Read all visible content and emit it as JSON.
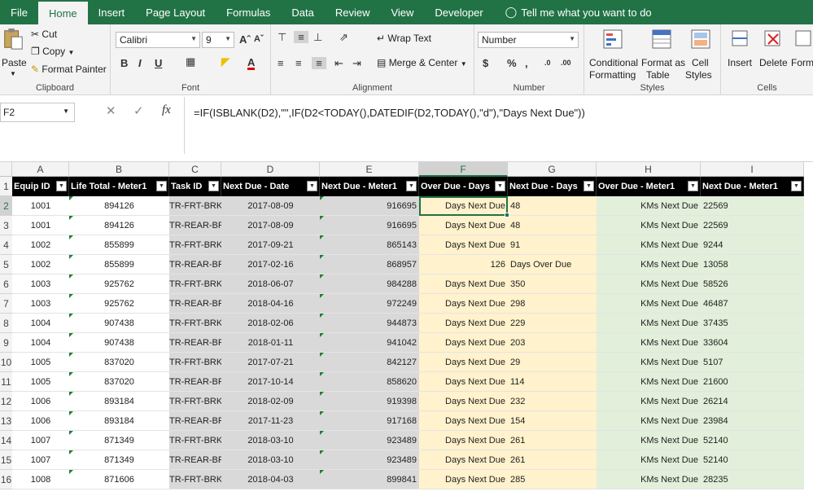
{
  "menu": {
    "tabs": [
      "File",
      "Home",
      "Insert",
      "Page Layout",
      "Formulas",
      "Data",
      "Review",
      "View",
      "Developer"
    ],
    "tell_me": "Tell me what you want to do"
  },
  "ribbon": {
    "clipboard": {
      "paste": "Paste",
      "cut": "Cut",
      "copy": "Copy",
      "format_painter": "Format Painter",
      "label": "Clipboard"
    },
    "font": {
      "name": "Calibri",
      "size": "9",
      "label": "Font"
    },
    "alignment": {
      "wrap_text": "Wrap Text",
      "merge_center": "Merge & Center",
      "label": "Alignment"
    },
    "number": {
      "format": "Number",
      "label": "Number"
    },
    "styles": {
      "conditional": "Conditional",
      "formatting": "Formatting",
      "format_as": "Format as",
      "table": "Table",
      "cell": "Cell",
      "styles_btn": "Styles",
      "label": "Styles"
    },
    "cells": {
      "insert": "Insert",
      "delete": "Delete",
      "format": "Forma",
      "label": "Cells"
    }
  },
  "formula_bar": {
    "name_box": "F2",
    "formula": "=IF(ISBLANK(D2),\"\",IF(D2<TODAY(),DATEDIF(D2,TODAY(),\"d\"),\"Days Next Due\"))"
  },
  "sheet": {
    "columns": [
      "A",
      "B",
      "C",
      "D",
      "E",
      "F",
      "G",
      "H",
      "I"
    ],
    "headers": [
      "Equip ID",
      "Life Total - Meter1",
      "Task ID",
      "Next Due - Date",
      "Next Due - Meter1",
      "Over Due - Days",
      "Next Due - Days",
      "Over Due - Meter1",
      "Next Due - Meter1"
    ],
    "row_numbers": [
      "1",
      "2",
      "3",
      "4",
      "5",
      "6",
      "7",
      "8",
      "9",
      "10",
      "11",
      "12",
      "13",
      "14",
      "15",
      "16"
    ],
    "rows": [
      [
        "1001",
        "894126",
        "TR-FRT-BRK",
        "2017-08-09",
        "916695",
        "Days Next Due",
        "48",
        "KMs Next Due",
        "22569"
      ],
      [
        "1001",
        "894126",
        "TR-REAR-BRK",
        "2017-08-09",
        "916695",
        "Days Next Due",
        "48",
        "KMs Next Due",
        "22569"
      ],
      [
        "1002",
        "855899",
        "TR-FRT-BRK",
        "2017-09-21",
        "865143",
        "Days Next Due",
        "91",
        "KMs Next Due",
        "9244"
      ],
      [
        "1002",
        "855899",
        "TR-REAR-BRK",
        "2017-02-16",
        "868957",
        "126",
        "Days Over Due",
        "KMs Next Due",
        "13058"
      ],
      [
        "1003",
        "925762",
        "TR-FRT-BRK",
        "2018-06-07",
        "984288",
        "Days Next Due",
        "350",
        "KMs Next Due",
        "58526"
      ],
      [
        "1003",
        "925762",
        "TR-REAR-BRK",
        "2018-04-16",
        "972249",
        "Days Next Due",
        "298",
        "KMs Next Due",
        "46487"
      ],
      [
        "1004",
        "907438",
        "TR-FRT-BRK",
        "2018-02-06",
        "944873",
        "Days Next Due",
        "229",
        "KMs Next Due",
        "37435"
      ],
      [
        "1004",
        "907438",
        "TR-REAR-BRK",
        "2018-01-11",
        "941042",
        "Days Next Due",
        "203",
        "KMs Next Due",
        "33604"
      ],
      [
        "1005",
        "837020",
        "TR-FRT-BRK",
        "2017-07-21",
        "842127",
        "Days Next Due",
        "29",
        "KMs Next Due",
        "5107"
      ],
      [
        "1005",
        "837020",
        "TR-REAR-BRK",
        "2017-10-14",
        "858620",
        "Days Next Due",
        "114",
        "KMs Next Due",
        "21600"
      ],
      [
        "1006",
        "893184",
        "TR-FRT-BRK",
        "2018-02-09",
        "919398",
        "Days Next Due",
        "232",
        "KMs Next Due",
        "26214"
      ],
      [
        "1006",
        "893184",
        "TR-REAR-BRK",
        "2017-11-23",
        "917168",
        "Days Next Due",
        "154",
        "KMs Next Due",
        "23984"
      ],
      [
        "1007",
        "871349",
        "TR-FRT-BRK",
        "2018-03-10",
        "923489",
        "Days Next Due",
        "261",
        "KMs Next Due",
        "52140"
      ],
      [
        "1007",
        "871349",
        "TR-REAR-BRK",
        "2018-03-10",
        "923489",
        "Days Next Due",
        "261",
        "KMs Next Due",
        "52140"
      ],
      [
        "1008",
        "871606",
        "TR-FRT-BRK",
        "2018-04-03",
        "899841",
        "Days Next Due",
        "285",
        "KMs Next Due",
        "28235"
      ]
    ],
    "fills": {
      "gray": "#d9d9d9",
      "yellow": "#fff2cc",
      "green": "#e2efda"
    }
  },
  "colors": {
    "accent": "#217346"
  }
}
